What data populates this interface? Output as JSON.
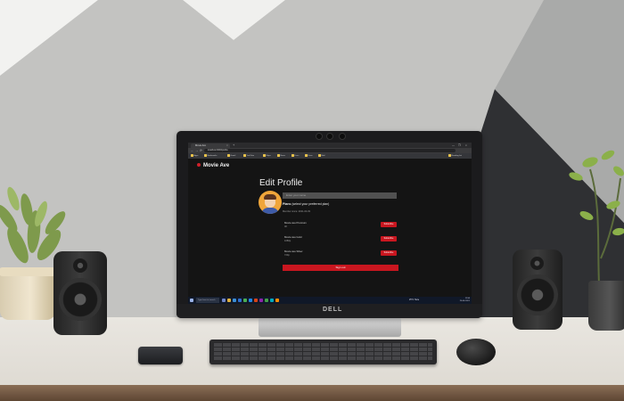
{
  "browser": {
    "tab_title": "Movie Ave",
    "tab_close": "×",
    "new_tab": "+",
    "window_controls": [
      "—",
      "❐",
      "×"
    ],
    "nav": [
      "←",
      "→",
      "⟳"
    ],
    "url": "localhost:3000/profile",
    "bookmarks": [
      "Apps",
      "Bookmarks",
      "Gmail",
      "YouTube",
      "Maps",
      "News",
      "Docs",
      "Drive",
      "Mail",
      "Reading list"
    ]
  },
  "app": {
    "brand": "Movie Ave",
    "page_title": "Edit Profile",
    "name_placeholder": "Enter your name",
    "plans_heading_bold": "Plans",
    "plans_heading_rest": "(select your preferred plan)",
    "member_since": "Member since: 2021-04-03",
    "plans": [
      {
        "name": "Movie ave Premium",
        "price": "4K",
        "button": "Subscribe"
      },
      {
        "name": "Movie ave Gold",
        "price": "1080p",
        "button": "Subscribe"
      },
      {
        "name": "Movie ave Silver",
        "price": "720p",
        "button": "Subscribe"
      }
    ],
    "signout_label": "Sign out"
  },
  "taskbar": {
    "search_placeholder": "Type here to search",
    "weather": "25°C Haze",
    "time": "11:56",
    "date": "20-04-2021"
  },
  "monitor_brand": "DELL",
  "colors": {
    "accent_red": "#c9161f",
    "page_bg": "#141414",
    "avatar_bg": "#f0a63a"
  }
}
